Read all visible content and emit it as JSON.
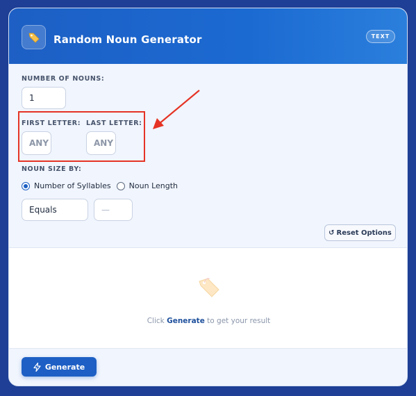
{
  "header": {
    "icon": "tag-icon",
    "title": "Random Noun Generator",
    "badge": "TEXT"
  },
  "form": {
    "number_label": "NUMBER OF NOUNS:",
    "number_value": "1",
    "first_letter_label": "FIRST LETTER:",
    "first_letter_placeholder": "ANY",
    "last_letter_label": "LAST LETTER:",
    "last_letter_placeholder": "ANY",
    "noun_size_label": "NOUN SIZE BY:",
    "radio_syllables": "Number of Syllables",
    "radio_length": "Noun Length",
    "selected_radio": "syllables",
    "comparison_value": "Equals",
    "size_placeholder": "—",
    "reset_label": "Reset Options"
  },
  "results": {
    "icon": "tag-icon",
    "prefix": "Click",
    "action": "Generate",
    "suffix": "to get your result"
  },
  "footer": {
    "generate_label": "Generate"
  },
  "annotations": {
    "highlight_color": "#e53325",
    "arrow_color": "#e53325"
  }
}
